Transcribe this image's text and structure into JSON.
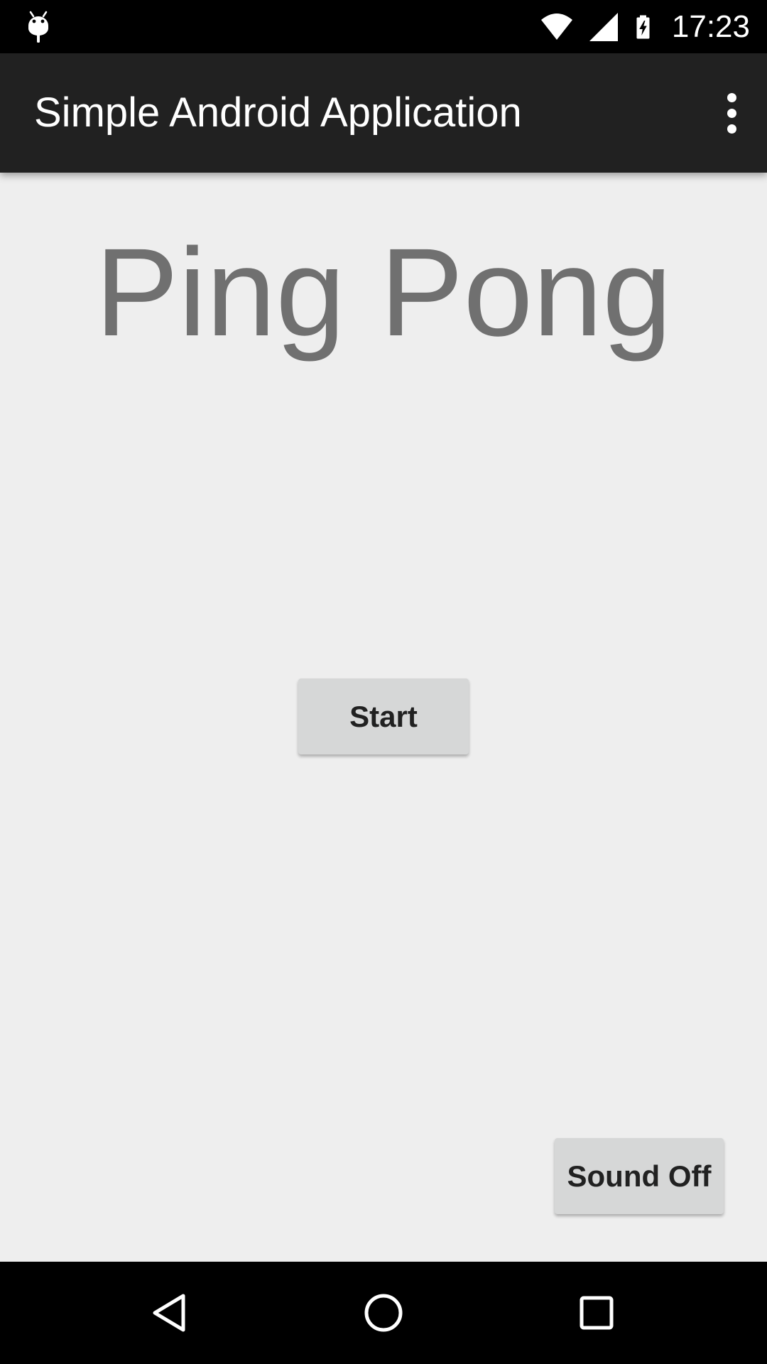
{
  "status_bar": {
    "notification_icon": "android-debug-icon",
    "wifi_icon": "wifi-icon",
    "signal_icon": "cell-signal-icon",
    "battery_icon": "battery-charging-icon",
    "time": "17:23"
  },
  "app_bar": {
    "title": "Simple Android Application",
    "overflow_icon": "more-vert-icon"
  },
  "main": {
    "title": "Ping Pong",
    "start_button_label": "Start",
    "sound_button_label": "Sound Off"
  },
  "nav_bar": {
    "back_icon": "back-icon",
    "home_icon": "home-icon",
    "recents_icon": "recents-icon"
  },
  "colors": {
    "status_bar": "#000000",
    "app_bar": "#212121",
    "background": "#eeeeee",
    "title_text": "#707070",
    "button_bg": "#d6d7d7",
    "button_text": "#212121"
  }
}
